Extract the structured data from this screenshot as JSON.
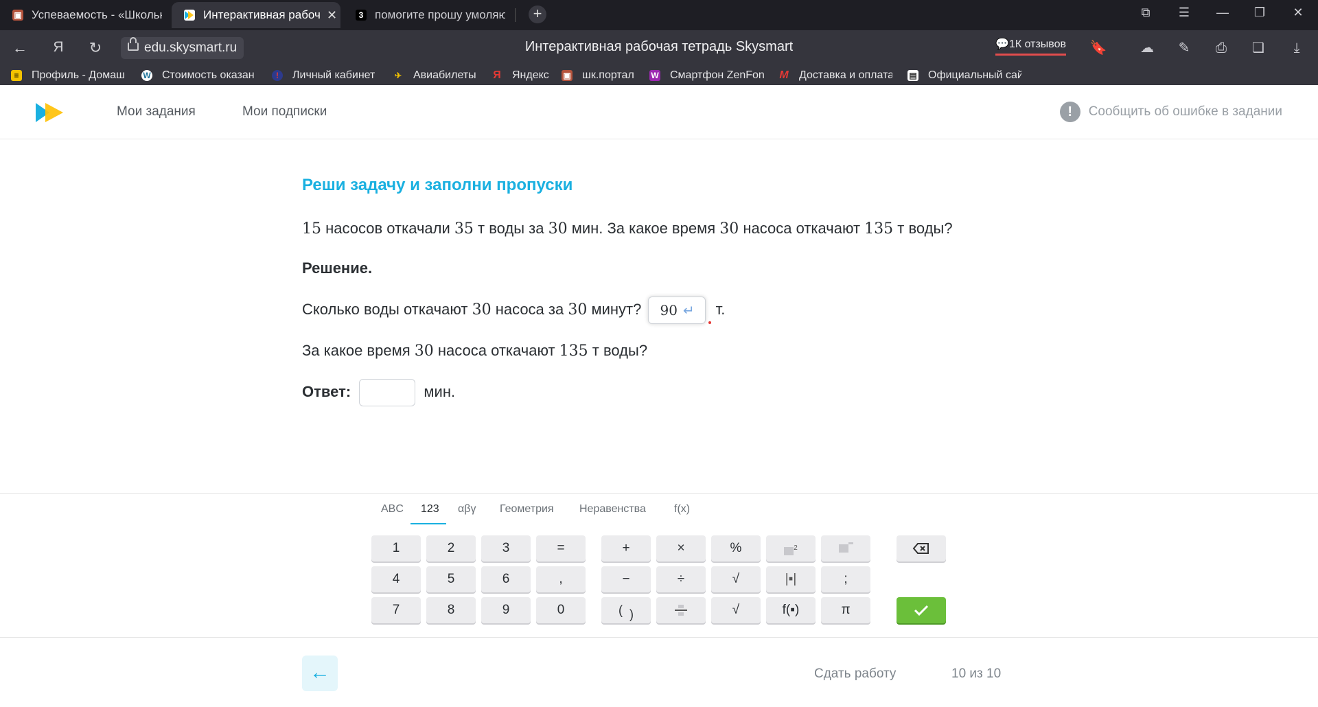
{
  "browser": {
    "tabs": [
      {
        "title": "Успеваемость - «Школьн",
        "icon": "school-portal-icon"
      },
      {
        "title": "Интерактивная рабоча",
        "icon": "skysmart-icon",
        "active": true
      },
      {
        "title": "помогите прошу умоляю",
        "icon": "znanija-icon"
      }
    ],
    "url": "edu.skysmart.ru",
    "page_title": "Интерактивная рабочая тетрадь Skysmart",
    "reviews": "1К отзывов",
    "bookmarks": [
      "Профиль - Домаш",
      "Стоимость оказан",
      "Личный кабинет",
      "Авиабилеты",
      "Яндекс",
      "шк.портал",
      "Смартфон ZenFon",
      "Доставка и оплата",
      "Официальный сай"
    ]
  },
  "site": {
    "nav": [
      "Мои задания",
      "Мои подписки"
    ],
    "report": "Сообщить об ошибке в задании",
    "brand_color": "#1ab0e0"
  },
  "task": {
    "heading": "Реши задачу и заполни пропуски",
    "problem": {
      "a": "15",
      "t1": " насосов откачали ",
      "b": "35",
      "t2": " т воды за ",
      "c": "30",
      "t3": " мин. За какое время ",
      "d": "30",
      "t4": " насоса откачают ",
      "e": "135",
      "t5": " т воды?"
    },
    "solution_label": "Решение.",
    "q1": {
      "t1": "Сколько воды откачают ",
      "a": "30",
      "t2": " насоса за ",
      "b": "30",
      "t3": " минут?",
      "value": "90",
      "unit": "т."
    },
    "q2": {
      "t1": "За какое время ",
      "a": "30",
      "t2": " насоса откачают ",
      "b": "135",
      "t3": " т воды?"
    },
    "answer_label": "Ответ:",
    "answer_value": "",
    "answer_unit": "мин."
  },
  "keyboard": {
    "tabs": [
      "ABC",
      "123",
      "αβγ",
      "Геометрия",
      "Неравенства",
      "f(x)"
    ],
    "active_tab": "123",
    "keys": {
      "k1": "1",
      "k2": "2",
      "k3": "3",
      "eq": "=",
      "k4": "4",
      "k5": "5",
      "k6": "6",
      "comma": ",",
      "k7": "7",
      "k8": "8",
      "k9": "9",
      "k0": "0",
      "plus": "+",
      "times": "×",
      "percent": "%",
      "minus": "−",
      "div": "÷",
      "sqrt": "√",
      "abs": "|▪|",
      "semicolon": ";",
      "sqrtn": "√",
      "func": "f(▪)",
      "pi": "π"
    }
  },
  "footer": {
    "submit": "Сдать работу",
    "counter": "10 из 10"
  }
}
